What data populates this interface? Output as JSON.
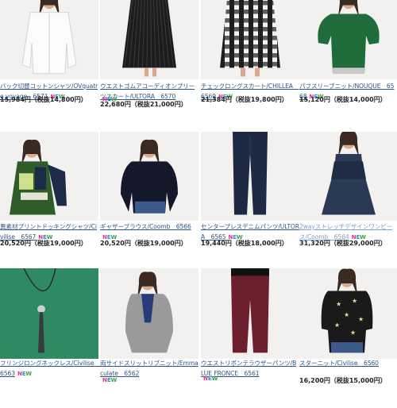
{
  "new_badge": "NEW",
  "products": [
    {
      "title": "バック切替コットンシャツ/OVquatre voyage　6571",
      "price": "15,984円（税抜14,800円）",
      "new_inline": true,
      "photo": "white-shirt-icon"
    },
    {
      "title": "ウエストゴムアコーディオンプリーツスカート/ULTORA　6570",
      "price": "22,680円（税抜21,000円）",
      "new_inline": false,
      "photo": "pleated-skirt-icon"
    },
    {
      "title": "チェックロングスカート/CHILLEA　6569",
      "price": "21,384円（税抜19,800円）",
      "new_inline": true,
      "photo": "check-skirt-icon"
    },
    {
      "title": "パフスリーブニット/NOUQUE　6568",
      "price": "15,120円（税抜14,000円）",
      "new_inline": true,
      "photo": "green-knit-icon"
    },
    {
      "title": "異素材プリントドッキングシャツ/Civilise　6567",
      "price": "20,520円（税抜19,000円）",
      "new_inline": true,
      "photo": "print-shirt-icon"
    },
    {
      "title": "ギャザーブラウス/Coomb　6566",
      "price": "20,520円（税抜19,000円）",
      "new_inline": true,
      "photo": "navy-blouse-icon"
    },
    {
      "title": "センタープレスデニムパンツ/ULTORA　6565",
      "price": "19,440円（税抜18,000円）",
      "new_inline": true,
      "photo": "denim-pants-icon"
    },
    {
      "title": "2wayストレッチデザインワンピース/Coomb　6564",
      "price": "31,320円（税抜29,000円）",
      "new_inline": true,
      "photo": "navy-dress-icon"
    },
    {
      "title": "フリンジロングネックレス/Civilise　6563",
      "price": "",
      "new_inline": true,
      "photo": "fringe-necklace-icon"
    },
    {
      "title": "両サイドスリットリブニット/Emmaculate　6562",
      "price": "",
      "new_inline": false,
      "photo": "grey-knit-icon"
    },
    {
      "title": "ウエストリボンテラウザーパンツ/BLUE FRONCE　6561",
      "price": "",
      "new_inline": false,
      "photo": "burgundy-pants-icon"
    },
    {
      "title": "スターニット/Civilise　6560",
      "price": "16,200円（税抜15,000円）",
      "new_inline": false,
      "photo": "star-knit-icon"
    }
  ]
}
